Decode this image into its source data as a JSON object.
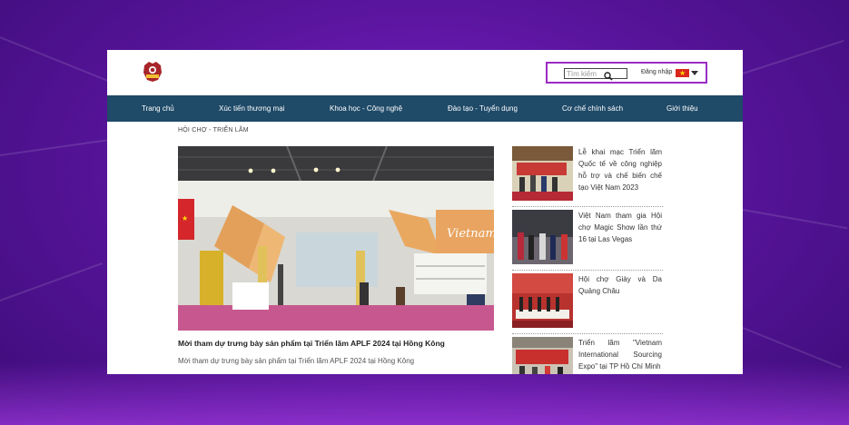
{
  "search": {
    "placeholder": "Tìm kiếm"
  },
  "header": {
    "login_label": "Đăng nhập"
  },
  "nav": [
    {
      "label": "Trang chủ"
    },
    {
      "label": "Xúc tiến thương mại"
    },
    {
      "label": "Khoa học - Công nghệ"
    },
    {
      "label": "Đào tạo - Tuyển dụng"
    },
    {
      "label": "Cơ chế chính sách"
    },
    {
      "label": "Giới thiệu"
    }
  ],
  "breadcrumb": "HỘI CHỢ - TRIỂN LÃM",
  "main_article": {
    "title": "Mời tham dự trưng bày sản phẩm tại Triển lãm APLF 2024 tại Hồng Kông",
    "summary": "Mời tham dự trưng bày sản phẩm tại Triển lãm APLF 2024 tại Hồng Kông"
  },
  "side_articles": [
    {
      "title": "Lễ khai mạc Triển lãm Quốc tế về công nghiệp hỗ trợ và chế biến chế tạo Việt Nam 2023"
    },
    {
      "title": "Việt Nam tham gia Hội chợ Magic Show lần thứ 16 tại Las Vegas"
    },
    {
      "title": "Hội chợ Giày và Da Quảng Châu"
    },
    {
      "title": "Triển lãm \"Vietnam International Sourcing Expo\" tại TP Hồ Chí Minh"
    }
  ],
  "colors": {
    "nav_bg": "#1f4a68",
    "highlight_border": "#9b2cc4",
    "background": "#5a159e"
  }
}
